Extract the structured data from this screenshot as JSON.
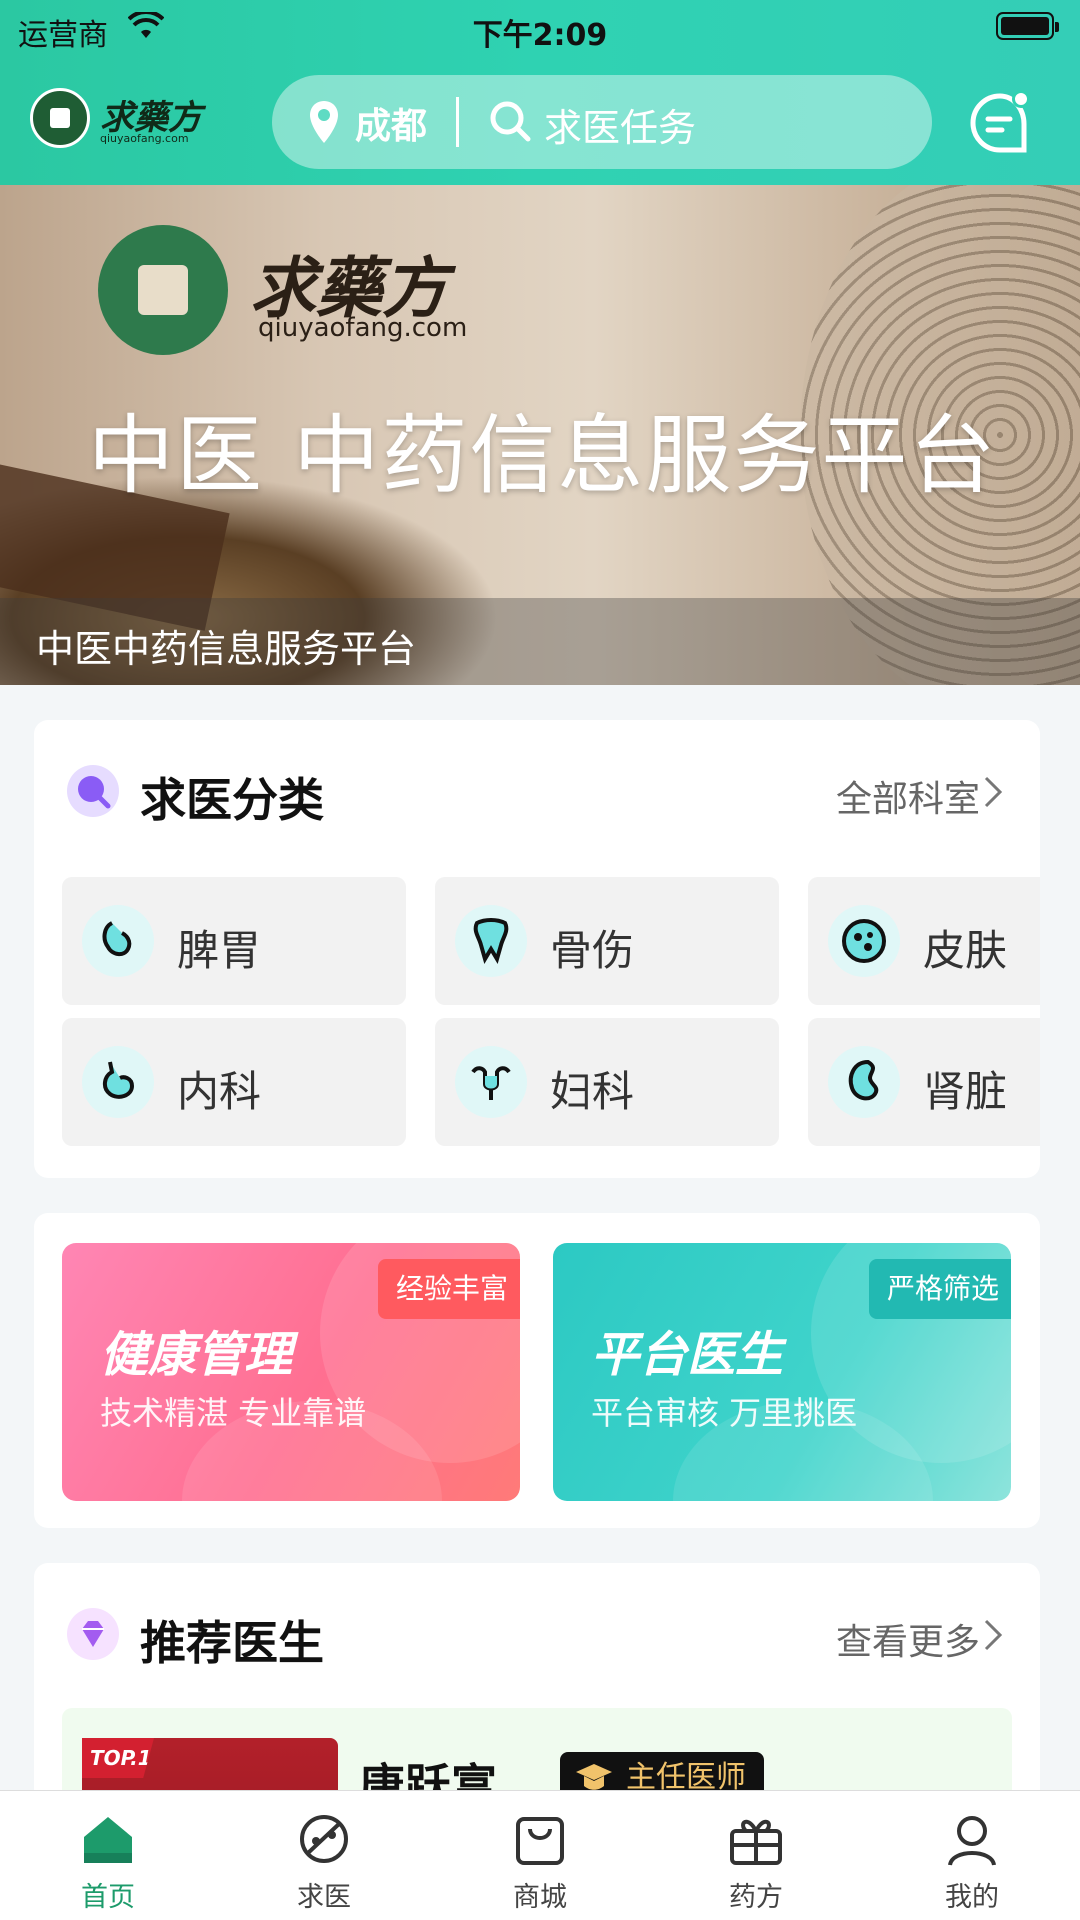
{
  "status_bar": {
    "carrier": "运营商",
    "time": "下午2:09"
  },
  "header": {
    "logo_brand": "求藥方",
    "logo_domain": "qiuyaofang.com",
    "city": "成都",
    "search_placeholder": "求医任务"
  },
  "banner": {
    "brand": "求藥方",
    "domain": "qiuyaofang.com",
    "headline": "中医 中药信息服务平台",
    "caption": "中医中药信息服务平台"
  },
  "category_section": {
    "title": "求医分类",
    "more": "全部科室",
    "items": [
      {
        "label": "脾胃",
        "icon": "stomach-icon"
      },
      {
        "label": "骨伤",
        "icon": "tooth-bone-icon"
      },
      {
        "label": "皮肤",
        "icon": "skin-icon"
      },
      {
        "label": "内科",
        "icon": "stomach-icon"
      },
      {
        "label": "妇科",
        "icon": "uterus-icon"
      },
      {
        "label": "肾脏",
        "icon": "kidney-icon"
      }
    ]
  },
  "promos": [
    {
      "title": "健康管理",
      "subtitle": "技术精湛 专业靠谱",
      "tag": "经验丰富"
    },
    {
      "title": "平台医生",
      "subtitle": "平台审核 万里挑医",
      "tag": "严格筛选"
    }
  ],
  "doctor_section": {
    "title": "推荐医生",
    "more": "查看更多",
    "doctors": [
      {
        "rank": "TOP.1",
        "name": "唐跃富",
        "title": "主任医师"
      }
    ]
  },
  "tabbar": {
    "items": [
      {
        "label": "首页",
        "icon": "home-icon",
        "active": true
      },
      {
        "label": "求医",
        "icon": "seek-doctor-icon",
        "active": false
      },
      {
        "label": "商城",
        "icon": "shopping-bag-icon",
        "active": false
      },
      {
        "label": "药方",
        "icon": "gift-box-icon",
        "active": false
      },
      {
        "label": "我的",
        "icon": "user-icon",
        "active": false
      }
    ]
  },
  "colors": {
    "brand": "#2fd2b2",
    "active_tab": "#1d9b6b",
    "pink_promo": "#ff6f91",
    "teal_promo": "#2cc9c3"
  }
}
